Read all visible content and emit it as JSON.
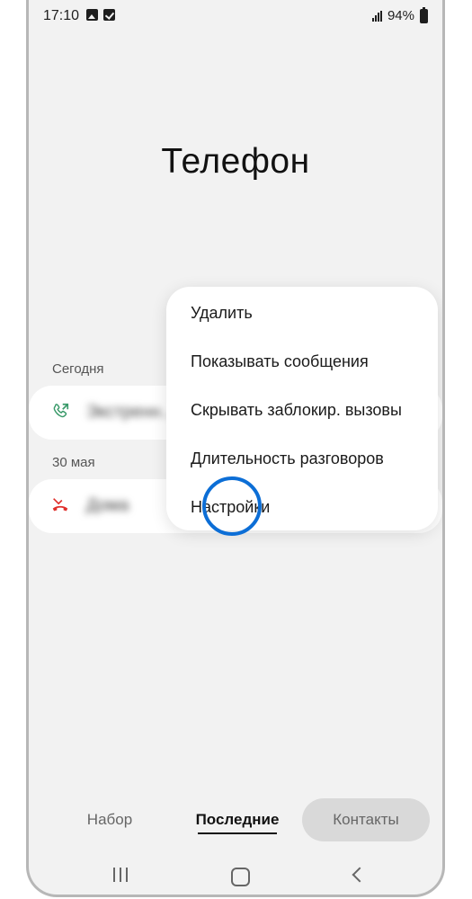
{
  "status": {
    "time": "17:10",
    "battery": "94%",
    "icons": [
      "image-icon",
      "checkbox-icon",
      "signal-icon",
      "battery-icon"
    ]
  },
  "page": {
    "title": "Телефон"
  },
  "recents": {
    "sections": [
      {
        "header": "Сегодня",
        "entry": {
          "name": "Экстренн…",
          "icon": "outgoing-call-icon",
          "color": "#3a9a6a"
        }
      },
      {
        "header": "30 мая",
        "entry": {
          "name": "Дома",
          "icon": "missed-call-icon",
          "color": "#e0302c"
        }
      }
    ]
  },
  "menu": {
    "items": [
      "Удалить",
      "Показывать сообщения",
      "Скрывать заблокир. вызовы",
      "Длительность разговоров",
      "Настройки"
    ],
    "highlight_color": "#0c6ed6"
  },
  "tabs": {
    "items": [
      "Набор",
      "Последние",
      "Контакты"
    ],
    "active": "Последние"
  },
  "navbar": {
    "icons": [
      "recent-apps-icon",
      "home-icon",
      "back-icon"
    ]
  }
}
